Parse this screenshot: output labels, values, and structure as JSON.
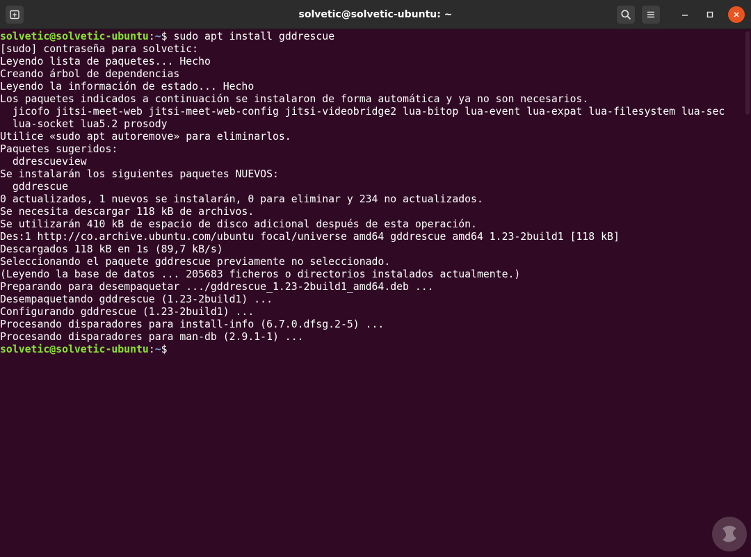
{
  "window": {
    "title": "solvetic@solvetic-ubuntu: ~",
    "icons": {
      "new_tab": "new-tab-icon",
      "search": "search-icon",
      "menu": "hamburger-menu-icon",
      "minimize": "minimize-icon",
      "maximize": "maximize-icon",
      "close": "close-icon"
    }
  },
  "colors": {
    "terminal_bg": "#300a24",
    "titlebar_bg": "#2c2c2c",
    "prompt_user": "#8ae234",
    "prompt_path": "#729fcf",
    "text": "#ffffff",
    "close_button": "#e95420"
  },
  "terminal": {
    "prompt1": {
      "user_host": "solvetic@solvetic-ubuntu",
      "sep": ":",
      "path": "~",
      "symbol": "$",
      "command": " sudo apt install gddrescue"
    },
    "output": [
      "[sudo] contraseña para solvetic:",
      "Leyendo lista de paquetes... Hecho",
      "Creando árbol de dependencias",
      "Leyendo la información de estado... Hecho",
      "Los paquetes indicados a continuación se instalaron de forma automática y ya no son necesarios.",
      "  jicofo jitsi-meet-web jitsi-meet-web-config jitsi-videobridge2 lua-bitop lua-event lua-expat lua-filesystem lua-sec",
      "  lua-socket lua5.2 prosody",
      "Utilice «sudo apt autoremove» para eliminarlos.",
      "Paquetes sugeridos:",
      "  ddrescueview",
      "Se instalarán los siguientes paquetes NUEVOS:",
      "  gddrescue",
      "0 actualizados, 1 nuevos se instalarán, 0 para eliminar y 234 no actualizados.",
      "Se necesita descargar 118 kB de archivos.",
      "Se utilizarán 410 kB de espacio de disco adicional después de esta operación.",
      "Des:1 http://co.archive.ubuntu.com/ubuntu focal/universe amd64 gddrescue amd64 1.23-2build1 [118 kB]",
      "Descargados 118 kB en 1s (89,7 kB/s)",
      "Seleccionando el paquete gddrescue previamente no seleccionado.",
      "(Leyendo la base de datos ... 205683 ficheros o directorios instalados actualmente.)",
      "Preparando para desempaquetar .../gddrescue_1.23-2build1_amd64.deb ...",
      "Desempaquetando gddrescue (1.23-2build1) ...",
      "Configurando gddrescue (1.23-2build1) ...",
      "Procesando disparadores para install-info (6.7.0.dfsg.2-5) ...",
      "Procesando disparadores para man-db (2.9.1-1) ..."
    ],
    "prompt2": {
      "user_host": "solvetic@solvetic-ubuntu",
      "sep": ":",
      "path": "~",
      "symbol": "$",
      "command": ""
    }
  },
  "watermark": {
    "name": "solvetic-logo"
  }
}
